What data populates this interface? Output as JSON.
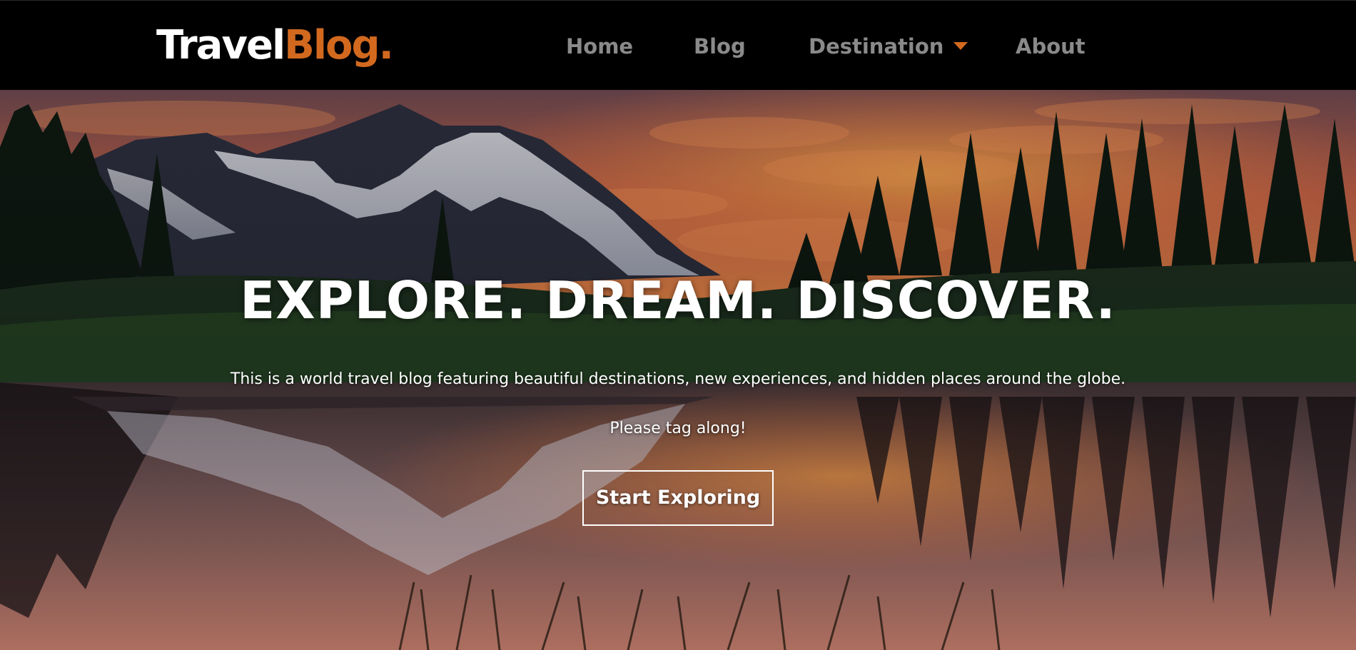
{
  "brand": {
    "part1": "Travel",
    "part2": "Blog."
  },
  "nav": {
    "home": "Home",
    "blog": "Blog",
    "destination": "Destination",
    "about": "About"
  },
  "hero": {
    "title": "EXPLORE. DREAM. DISCOVER.",
    "description": "This is a world travel blog featuring beautiful destinations, new experiences, and hidden places around the globe.",
    "tagline": "Please tag along!",
    "cta_label": "Start Exploring"
  },
  "colors": {
    "accent": "#d2691e",
    "nav_text": "#8a8a8a",
    "navbar_bg": "#000000"
  }
}
